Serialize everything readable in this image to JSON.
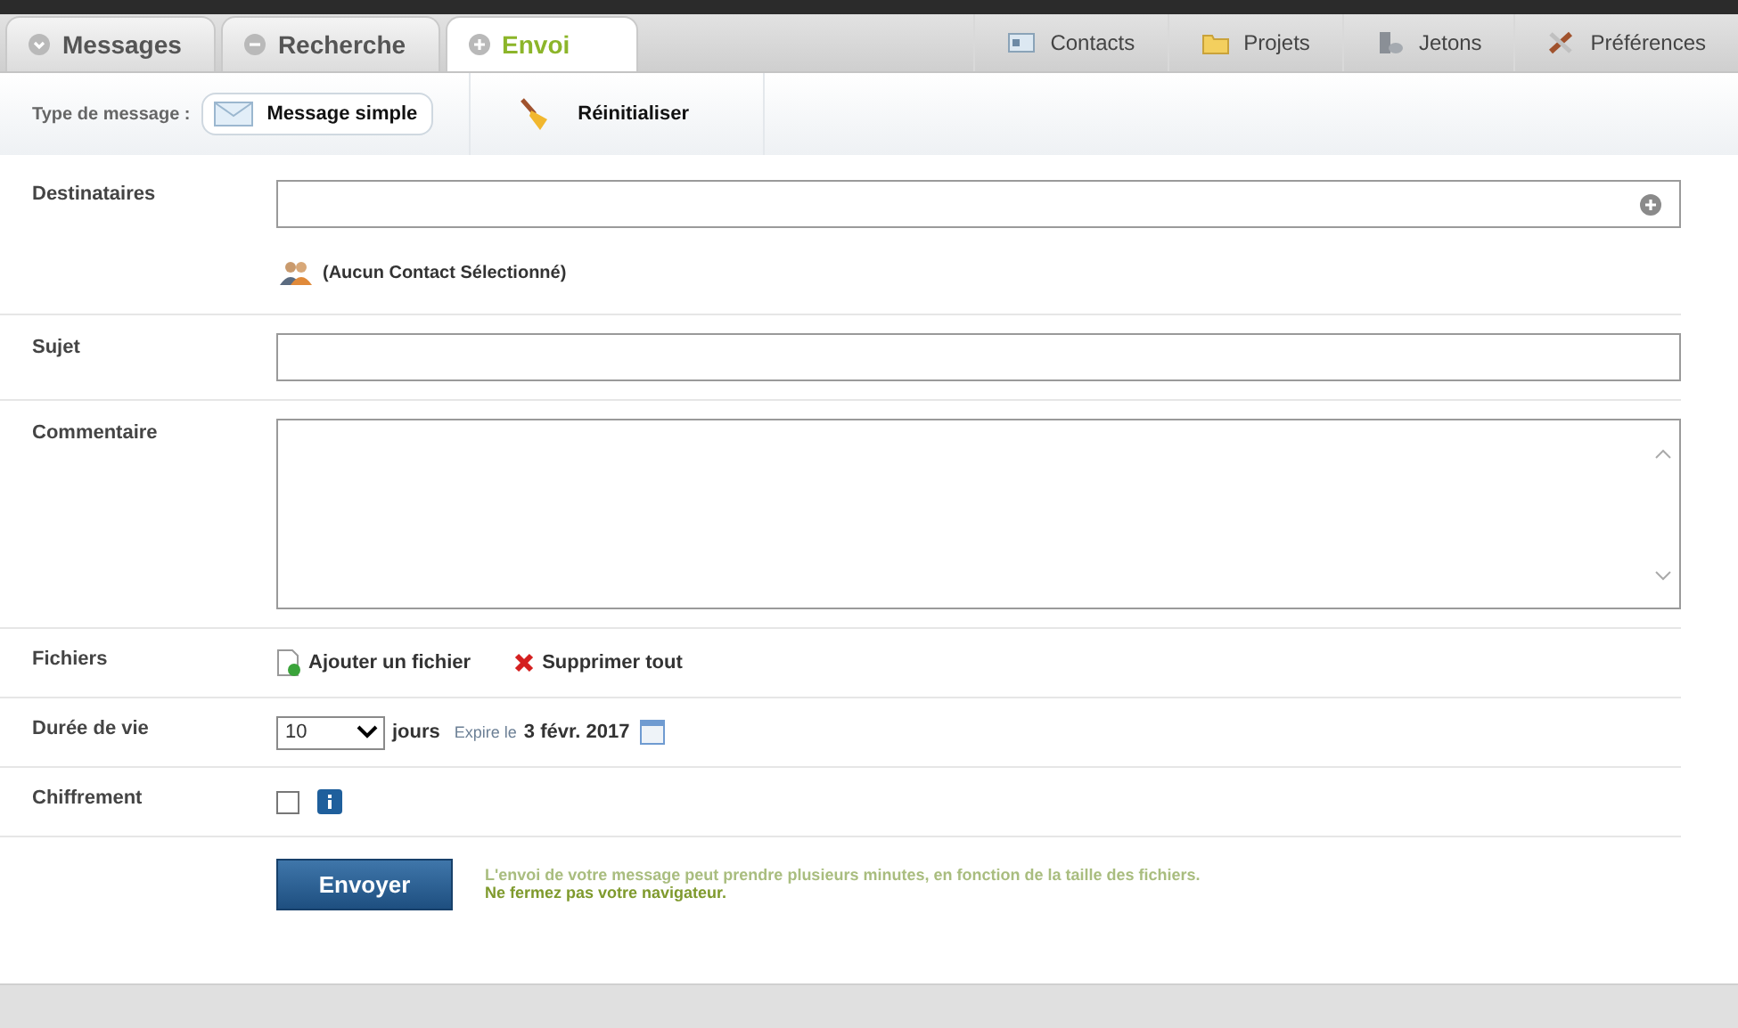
{
  "tabs": [
    {
      "label": "Messages",
      "selected": false
    },
    {
      "label": "Recherche",
      "selected": false
    },
    {
      "label": "Envoi",
      "selected": true
    }
  ],
  "top_links": [
    "Contacts",
    "Projets",
    "Jetons",
    "Préférences"
  ],
  "toolbar": {
    "type_label": "Type de message :",
    "type_value": "Message simple",
    "reset": "Réinitialiser"
  },
  "form": {
    "recipients": {
      "label": "Destinataires",
      "contacts": "(Aucun Contact Sélectionné)"
    },
    "subject": {
      "label": "Sujet"
    },
    "comment": {
      "label": "Commentaire"
    },
    "files": {
      "label": "Fichiers",
      "add": "Ajouter un fichier",
      "remove_all": "Supprimer tout"
    },
    "lifetime": {
      "label": "Durée de vie",
      "value": "10",
      "unit": "jours",
      "expires_label": "Expire le",
      "expires_date": "3 févr. 2017"
    },
    "encryption": {
      "label": "Chiffrement",
      "checked": false
    },
    "send": "Envoyer",
    "notice": "L'envoi de votre message peut prendre plusieurs minutes, en fonction de la taille des fichiers.",
    "warning": "Ne fermez pas votre navigateur."
  }
}
